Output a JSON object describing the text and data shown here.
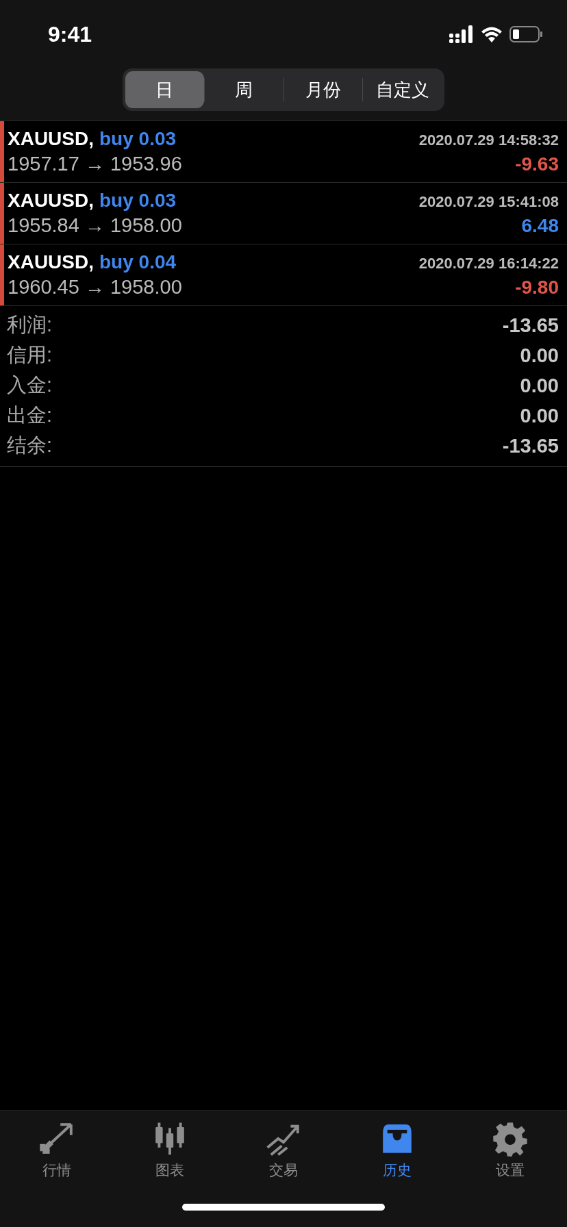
{
  "status_bar": {
    "time": "9:41"
  },
  "segments": [
    {
      "label": "日",
      "selected": true
    },
    {
      "label": "周",
      "selected": false
    },
    {
      "label": "月份",
      "selected": false
    },
    {
      "label": "自定义",
      "selected": false
    }
  ],
  "deals": [
    {
      "symbol": "XAUUSD,",
      "side": "buy 0.03",
      "time": "2020.07.29 14:58:32",
      "prices": "1957.17 → 1953.96",
      "profit": "-9.63",
      "color": "#e0564a"
    },
    {
      "symbol": "XAUUSD,",
      "side": "buy 0.03",
      "time": "2020.07.29 15:41:08",
      "prices": "1955.84 → 1958.00",
      "profit": "6.48",
      "color": "#3f86ee"
    },
    {
      "symbol": "XAUUSD,",
      "side": "buy 0.04",
      "time": "2020.07.29 16:14:22",
      "prices": "1960.45 → 1958.00",
      "profit": "-9.80",
      "color": "#e0564a"
    }
  ],
  "summary": [
    {
      "label": "利润:",
      "value": "-13.65"
    },
    {
      "label": "信用:",
      "value": "0.00"
    },
    {
      "label": "入金:",
      "value": "0.00"
    },
    {
      "label": "出金:",
      "value": "0.00"
    },
    {
      "label": "结余:",
      "value": "-13.65"
    }
  ],
  "tab_bar": [
    {
      "label": "行情",
      "kind": "quotes",
      "selected": false
    },
    {
      "label": "图表",
      "kind": "chart",
      "selected": false
    },
    {
      "label": "交易",
      "kind": "trade",
      "selected": false
    },
    {
      "label": "历史",
      "kind": "history",
      "selected": true
    },
    {
      "label": "设置",
      "kind": "settings",
      "selected": false
    }
  ]
}
